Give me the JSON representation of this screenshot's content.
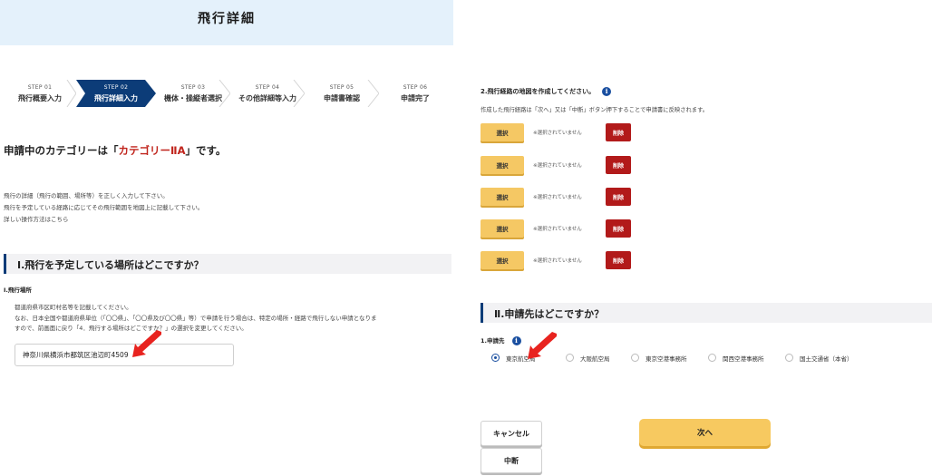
{
  "header": {
    "title": "飛行詳細"
  },
  "steps": [
    {
      "num": "STEP 01",
      "name": "飛行概要入力",
      "active": false
    },
    {
      "num": "STEP 02",
      "name": "飛行詳細入力",
      "active": true
    },
    {
      "num": "STEP 03",
      "name": "機体・操縦者選択",
      "active": false
    },
    {
      "num": "STEP 04",
      "name": "その他詳細等入力",
      "active": false
    },
    {
      "num": "STEP 05",
      "name": "申請書確認",
      "active": false
    },
    {
      "num": "STEP 06",
      "name": "申請完了",
      "active": false
    }
  ],
  "category": {
    "prefix": "申請中のカテゴリーは「",
    "name": "カテゴリーⅡA",
    "suffix": "」です。"
  },
  "intro": {
    "line1": "飛行の詳細（飛行の範囲、場所等）を正しく入力して下さい。",
    "line2": "飛行を予定している経路に応じてその飛行範囲を地図上に記載して下さい。",
    "link": "詳しい操作方法はこちら"
  },
  "section1": {
    "title": "Ⅰ.飛行を予定している場所はどこですか？",
    "q_label": "Ⅰ.飛行場所",
    "desc1": "都道府県市区町村名等を記載してください。",
    "desc2": "なお、日本全国や都道府県単位（「〇〇県」、「〇〇県及び〇〇県」等）で申請を行う場合は、特定の場所・経路で飛行しない申請となりま",
    "desc3": "すので、前画面に戻り「4．飛行する場所はどこですか？」の選択を変更してください。",
    "location_value": "神奈川県横浜市都筑区池辺町4509"
  },
  "map": {
    "title": "2.飛行経路の地図を作成してください。",
    "info": "i",
    "desc": "作成した飛行経路は「次へ」又は「中断」ボタン押下することで申請書に反映されます。",
    "rows": [
      {
        "select": "選択",
        "status": "※選択されていません",
        "delete": "削除"
      },
      {
        "select": "選択",
        "status": "※選択されていません",
        "delete": "削除"
      },
      {
        "select": "選択",
        "status": "※選択されていません",
        "delete": "削除"
      },
      {
        "select": "選択",
        "status": "※選択されていません",
        "delete": "削除"
      },
      {
        "select": "選択",
        "status": "※選択されていません",
        "delete": "削除"
      }
    ]
  },
  "section2": {
    "title": "Ⅱ.申請先はどこですか？",
    "q_label": "1.申請先",
    "info": "i",
    "options": [
      {
        "label": "東京航空局",
        "checked": true
      },
      {
        "label": "大阪航空局",
        "checked": false
      },
      {
        "label": "東京空港事務所",
        "checked": false
      },
      {
        "label": "関西空港事務所",
        "checked": false
      },
      {
        "label": "国土交通省（本省）",
        "checked": false
      }
    ]
  },
  "buttons": {
    "cancel": "キャンセル",
    "suspend": "中断",
    "next": "次へ"
  },
  "colors": {
    "accent_blue": "#0c3c78",
    "category_red": "#c0241c",
    "arrow_red": "#e8231f",
    "button_yellow": "#f5c864",
    "delete_red": "#b21a1a"
  }
}
